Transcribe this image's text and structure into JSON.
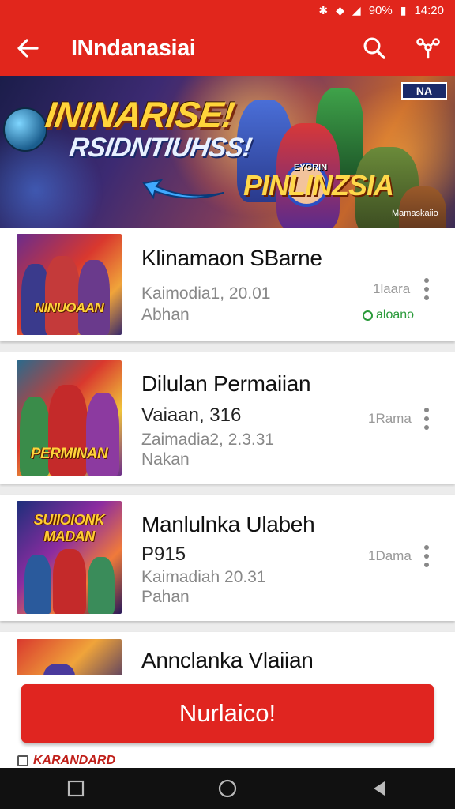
{
  "status_bar": {
    "time": "14:20",
    "battery": "90%",
    "icons": [
      "bluetooth-icon",
      "wifi-icon",
      "signal-icon",
      "battery-icon"
    ]
  },
  "app_bar": {
    "title": "INndanasiai",
    "back_icon": "arrow-left-icon",
    "search_icon": "search-icon",
    "share_icon": "share-icon"
  },
  "banner": {
    "headline": "ININARISE!",
    "subline": "RSIDNTIUHSS!",
    "brand": "PINLINZSIA",
    "brand_small": "EYGRIN",
    "badge": "NA",
    "credit": "Mamaskaiio"
  },
  "games": [
    {
      "name": "Klinamaon SBarne",
      "thumb_text": "NINUOAAN",
      "line1": "Kaimodia1, 20.01",
      "line2": "Abhan",
      "size": "1laara",
      "status": "aloano"
    },
    {
      "name": "Dilulan Permaiian",
      "thumb_text": "PERMINAN",
      "line1": "Vaiaan, 316",
      "line2": "Zaimadia2, 2.3.31",
      "line3": "Nakan",
      "size": "1Rama"
    },
    {
      "name": "Manlulnka Ulabeh",
      "thumb_text": "SUIIOIONK MADAN",
      "line1": "P915",
      "line2": "Kaimadiah 20.31",
      "line3": "Pahan",
      "size": "1Dama"
    },
    {
      "name": "Annclanka Vlaiian",
      "thumb_text": ""
    }
  ],
  "cta": {
    "label": "Nurlaico!"
  },
  "footer": {
    "logo_text": "KARANDARD"
  },
  "nav_bar": {
    "recents_icon": "square-icon",
    "home_icon": "circle-icon",
    "back_icon": "triangle-back-icon"
  },
  "colors": {
    "brand_red": "#e1261c",
    "cta_red": "#e02520",
    "status_green": "#2a9a3a",
    "nav_black": "#111111"
  }
}
